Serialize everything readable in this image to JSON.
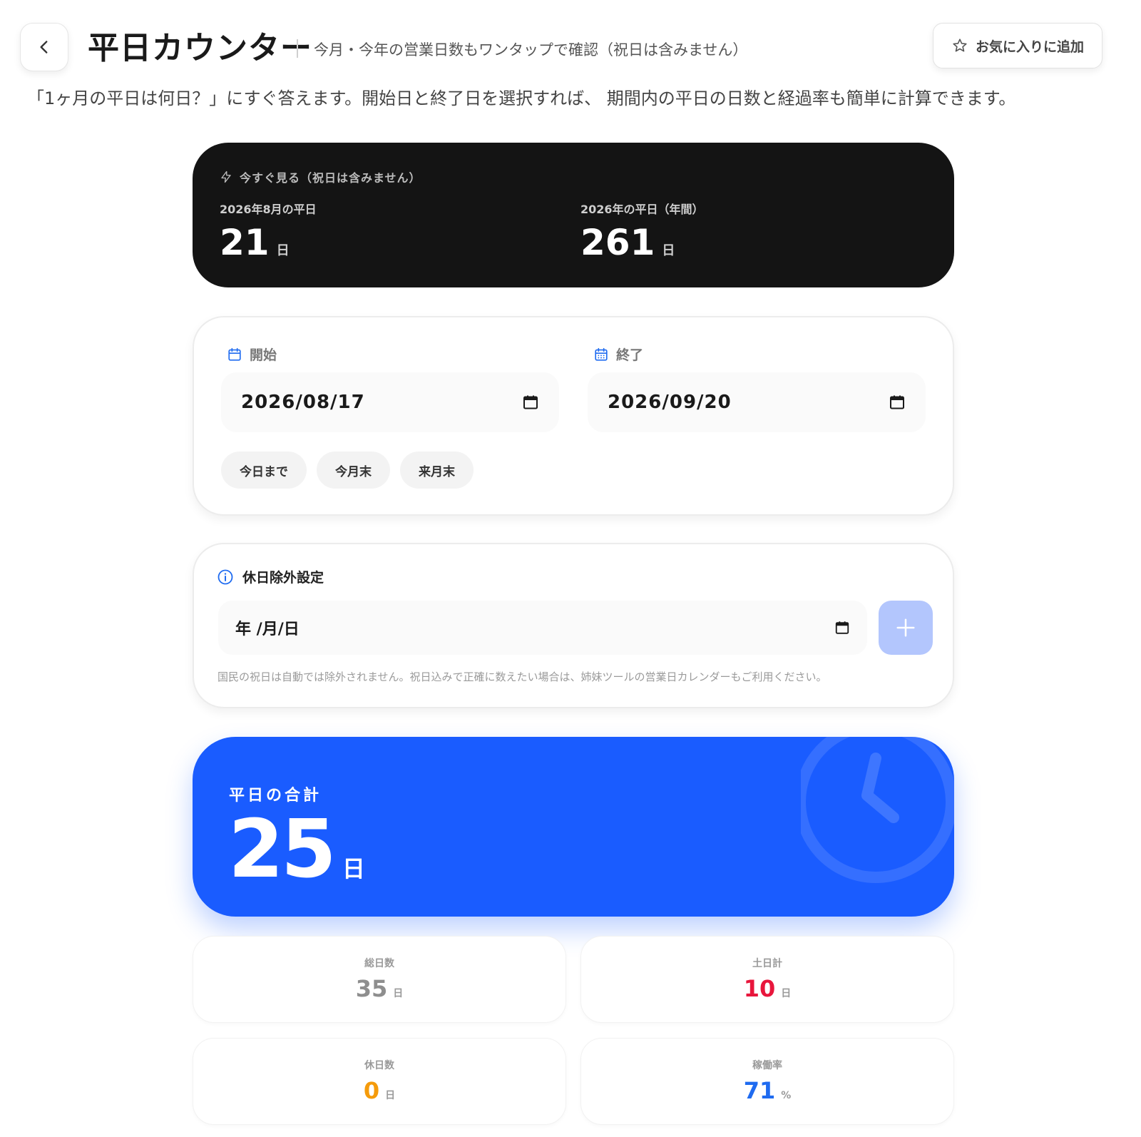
{
  "header": {
    "title": "平日カウンター",
    "subtitle": "今月・今年の営業日数もワンタップで確認（祝日は含みません）",
    "favorite_label": "お気に入りに追加"
  },
  "intro": "「1ヶ月の平日は何日？」にすぐ答えます。開始日と終了日を選択すれば、 期間内の平日の日数と経過率も簡単に計算できます。",
  "quick_view": {
    "heading": "今すぐ見る（祝日は含みません）",
    "month": {
      "label": "2026年8月の平日",
      "value": "21",
      "unit": "日"
    },
    "year": {
      "label": "2026年の平日（年間）",
      "value": "261",
      "unit": "日"
    }
  },
  "period": {
    "start_label": "開始",
    "start_value": "2026/08/17",
    "end_label": "終了",
    "end_value": "2026/09/20",
    "presets": [
      "今日まで",
      "今月末",
      "来月末"
    ]
  },
  "holiday": {
    "heading": "休日除外設定",
    "input_placeholder": "年 /月/日",
    "note": "国民の祝日は自動では除外されません。祝日込みで正確に数えたい場合は、姉妹ツールの営業日カレンダーもご利用ください。"
  },
  "total": {
    "label": "平日の合計",
    "value": "25",
    "unit": "日"
  },
  "stats": [
    {
      "label": "総日数",
      "value": "35",
      "unit": "日",
      "color": "#8e8e8e"
    },
    {
      "label": "土日計",
      "value": "10",
      "unit": "日",
      "color": "#e8163c"
    },
    {
      "label": "休日数",
      "value": "0",
      "unit": "日",
      "color": "#f59b0b"
    },
    {
      "label": "稼働率",
      "value": "71",
      "unit": "%",
      "color": "#1f6bf0"
    }
  ],
  "colors": {
    "accent_blue": "#1a5cff",
    "dark_card": "#141414",
    "add_button": "#b3c6fd"
  },
  "icons": {
    "back": "chevron-left-icon",
    "favorite": "star-outline-icon",
    "quick": "lightning-icon",
    "calendar": "calendar-icon",
    "info": "info-circle-icon",
    "add": "plus-icon",
    "decoration": "clock-icon"
  }
}
